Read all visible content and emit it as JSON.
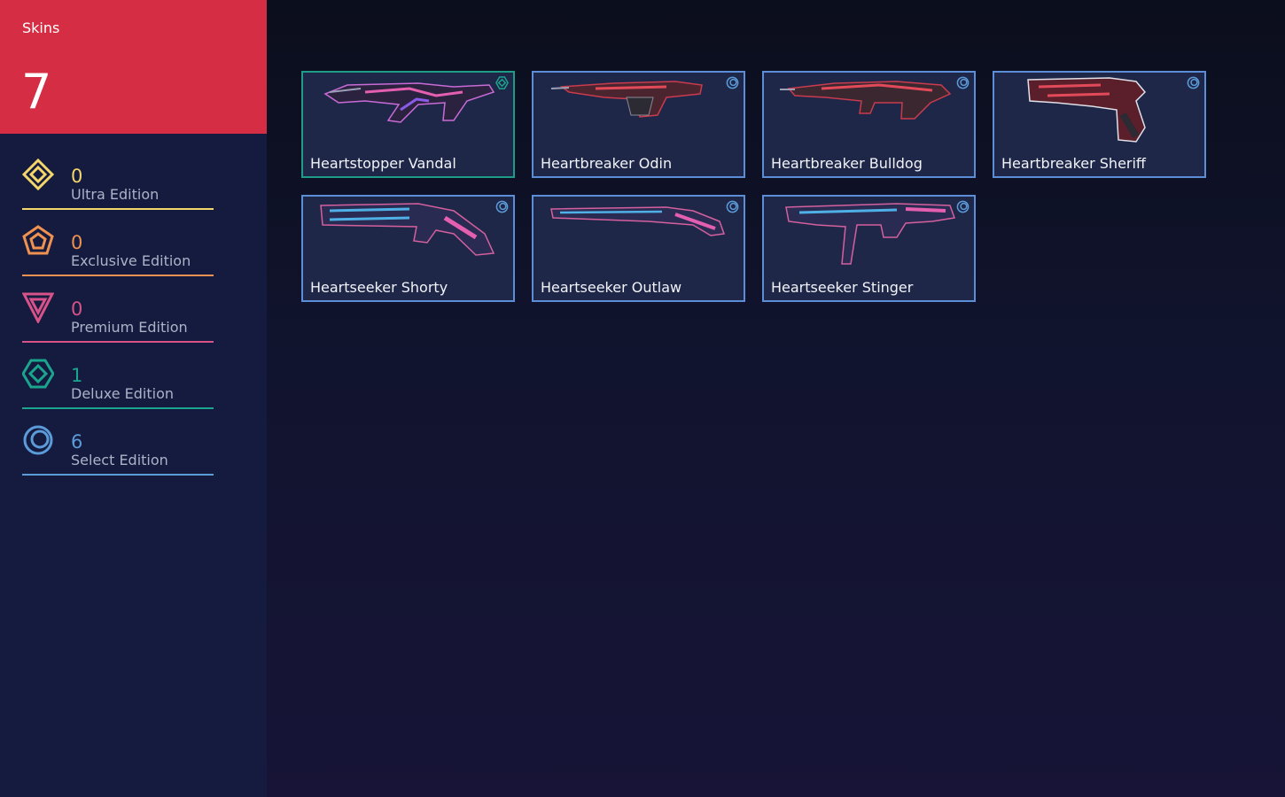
{
  "sidebar": {
    "title": "Skins",
    "total": "7",
    "header_color": "#d52d43",
    "tiers": [
      {
        "icon": "ultra-edition-icon",
        "count": "0",
        "label": "Ultra Edition",
        "color": "#f5d66b"
      },
      {
        "icon": "exclusive-edition-icon",
        "count": "0",
        "label": "Exclusive Edition",
        "color": "#ef9150"
      },
      {
        "icon": "premium-edition-icon",
        "count": "0",
        "label": "Premium Edition",
        "color": "#d8528a"
      },
      {
        "icon": "deluxe-edition-icon",
        "count": "1",
        "label": "Deluxe Edition",
        "color": "#1aa58f"
      },
      {
        "icon": "select-edition-icon",
        "count": "6",
        "label": "Select Edition",
        "color": "#5c9bd9"
      }
    ]
  },
  "skins": [
    {
      "name": "Heartstopper Vandal",
      "tier": "deluxe",
      "tier_icon": "deluxe-edition-icon",
      "selected": true
    },
    {
      "name": "Heartbreaker Odin",
      "tier": "select",
      "tier_icon": "select-edition-icon",
      "selected": false
    },
    {
      "name": "Heartbreaker Bulldog",
      "tier": "select",
      "tier_icon": "select-edition-icon",
      "selected": false
    },
    {
      "name": "Heartbreaker Sheriff",
      "tier": "select",
      "tier_icon": "select-edition-icon",
      "selected": false
    },
    {
      "name": "Heartseeker Shorty",
      "tier": "select",
      "tier_icon": "select-edition-icon",
      "selected": false
    },
    {
      "name": "Heartseeker Outlaw",
      "tier": "select",
      "tier_icon": "select-edition-icon",
      "selected": false
    },
    {
      "name": "Heartseeker Stinger",
      "tier": "select",
      "tier_icon": "select-edition-icon",
      "selected": false
    }
  ]
}
